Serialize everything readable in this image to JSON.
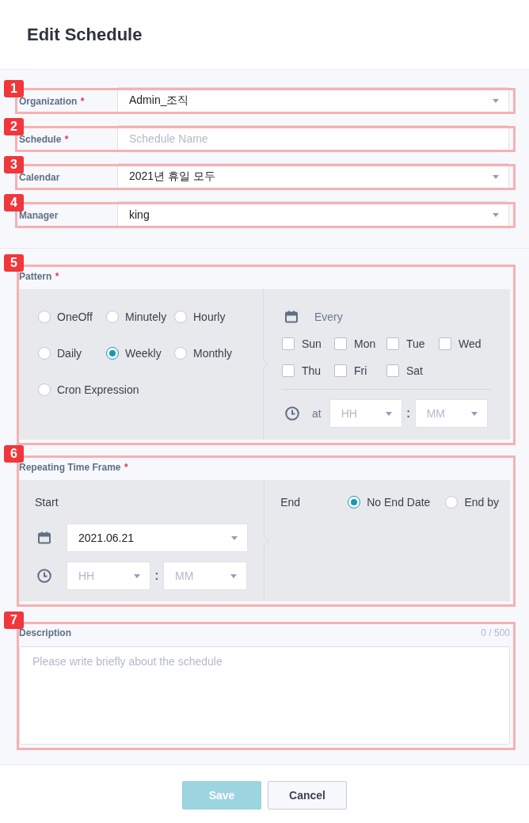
{
  "title": "Edit Schedule",
  "fields": [
    {
      "callout": "1",
      "label": "Organization",
      "required_mark": "*",
      "kind": "select",
      "value": "Admin_조직"
    },
    {
      "callout": "2",
      "label": "Schedule",
      "required_mark": "*",
      "kind": "text",
      "placeholder": "Schedule Name"
    },
    {
      "callout": "3",
      "label": "Calendar",
      "kind": "select",
      "value": "2021년 휴일 모두"
    },
    {
      "callout": "4",
      "label": "Manager",
      "kind": "select",
      "value": "king"
    }
  ],
  "pattern": {
    "callout": "5",
    "label": "Pattern",
    "required_mark": "*",
    "options": [
      {
        "label": "OneOff",
        "selected": false
      },
      {
        "label": "Minutely",
        "selected": false
      },
      {
        "label": "Hourly",
        "selected": false
      },
      {
        "label": "Daily",
        "selected": false
      },
      {
        "label": "Weekly",
        "selected": true
      },
      {
        "label": "Monthly",
        "selected": false
      },
      {
        "label": "Cron Expression",
        "selected": false
      }
    ],
    "every_label": "Every",
    "days": [
      {
        "label": "Sun",
        "checked": false
      },
      {
        "label": "Mon",
        "checked": false
      },
      {
        "label": "Tue",
        "checked": false
      },
      {
        "label": "Wed",
        "checked": false
      },
      {
        "label": "Thu",
        "checked": false
      },
      {
        "label": "Fri",
        "checked": false
      },
      {
        "label": "Sat",
        "checked": false
      }
    ],
    "at_label": "at",
    "hour_placeholder": "HH",
    "separator": ":",
    "minute_placeholder": "MM"
  },
  "time_frame": {
    "callout": "6",
    "label": "Repeating Time Frame",
    "required_mark": "*",
    "start_label": "Start",
    "start_date": "2021.06.21",
    "hour_placeholder": "HH",
    "separator": ":",
    "minute_placeholder": "MM",
    "end_label": "End",
    "end_options": [
      {
        "label": "No End Date",
        "selected": true
      },
      {
        "label": "End by",
        "selected": false
      }
    ]
  },
  "description": {
    "callout": "7",
    "label": "Description",
    "counter": "0 / 500",
    "placeholder": "Please write briefly about the schedule"
  },
  "buttons": [
    {
      "label": "Save",
      "kind": "primary",
      "disabled": true
    },
    {
      "label": "Cancel",
      "kind": "secondary",
      "disabled": false
    }
  ]
}
